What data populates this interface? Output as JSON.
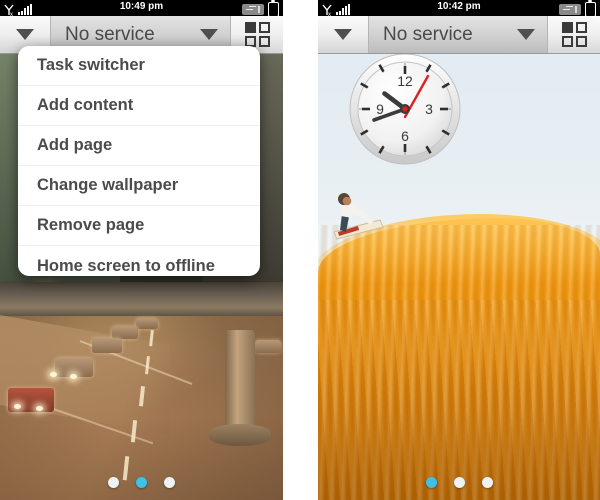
{
  "panels": [
    {
      "id": "left",
      "statusbar": {
        "time": "10:49 pm",
        "signal_icon": "no-signal-icon",
        "bars_icon": "signal-bars-icon",
        "badge_icon": "status-badge-icon",
        "battery_icon": "battery-icon"
      },
      "header": {
        "dropdown_icon": "chevron-down-icon",
        "operator": "No service",
        "operator_dropdown_icon": "chevron-down-icon",
        "grid_icon": "app-grid-icon"
      },
      "wallpaper_name": "night-street-overpass-wallpaper",
      "menu": {
        "items": [
          {
            "label": "Task switcher"
          },
          {
            "label": "Add content"
          },
          {
            "label": "Add page"
          },
          {
            "label": "Change wallpaper"
          },
          {
            "label": "Remove page"
          },
          {
            "label": "Home screen to offline"
          }
        ]
      },
      "page_dots": {
        "count": 3,
        "active_index": 1
      }
    },
    {
      "id": "right",
      "statusbar": {
        "time": "10:42 pm",
        "signal_icon": "no-signal-icon",
        "bars_icon": "signal-bars-icon",
        "badge_icon": "status-badge-icon",
        "battery_icon": "battery-icon"
      },
      "header": {
        "dropdown_icon": "chevron-down-icon",
        "operator": "No service",
        "operator_dropdown_icon": "chevron-down-icon",
        "grid_icon": "app-grid-icon"
      },
      "wallpaper_name": "desert-dune-sandboarder-wallpaper",
      "clock": {
        "name": "analog-clock-widget",
        "numerals": [
          "12",
          "3",
          "6",
          "9"
        ],
        "hour_hand_angle": -45,
        "minute_hand_angle": 252,
        "second_hand_angle": 25
      },
      "page_dots": {
        "count": 3,
        "active_index": 0
      }
    }
  ],
  "colors": {
    "accent_dot": "#3fc0e8",
    "statusbar_bg": "#000000",
    "header_text": "#4a4a4a",
    "menu_text": "#4b4b4b",
    "second_hand": "#e02020",
    "sand": "#f29a11"
  }
}
